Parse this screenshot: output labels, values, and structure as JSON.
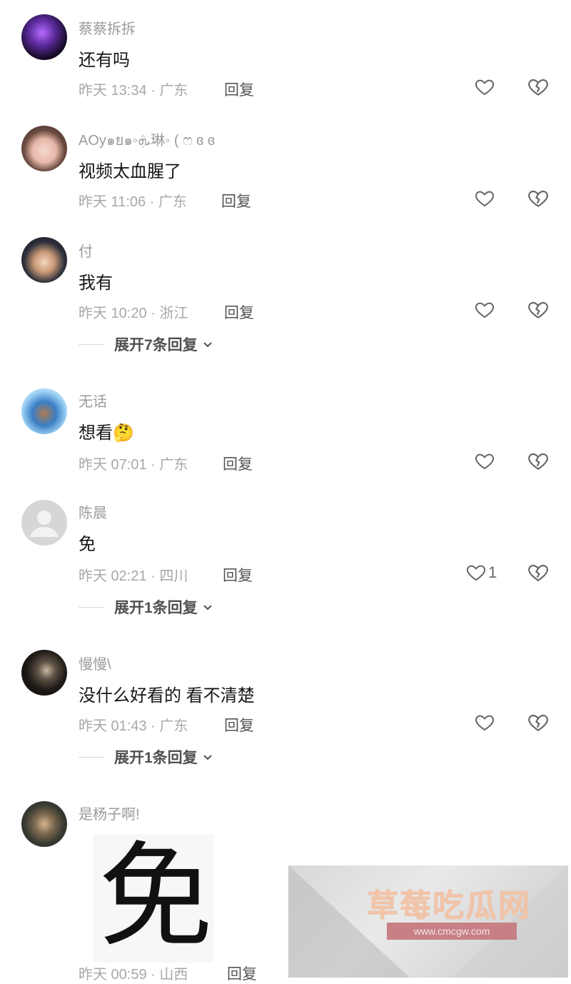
{
  "comments": [
    {
      "user": "蔡蔡拆拆",
      "text": "还有吗",
      "time": "昨天 13:34 · 广东",
      "reply": "回复",
      "likes": ""
    },
    {
      "user": "AOy๑ย๑◦ܞ琳◦ ( ෆ ɞ ɞ",
      "text": "视频太血腥了",
      "time": "昨天 11:06 · 广东",
      "reply": "回复",
      "likes": ""
    },
    {
      "user": "付",
      "text": "我有",
      "time": "昨天 10:20 · 浙江",
      "reply": "回复",
      "likes": "",
      "expand": "展开7条回复"
    },
    {
      "user": "无话",
      "text": "想看",
      "emoji": "🤔",
      "time": "昨天 07:01 · 广东",
      "reply": "回复",
      "likes": ""
    },
    {
      "user": "陈晨",
      "text": "免",
      "time": "昨天 02:21 · 四川",
      "reply": "回复",
      "likes": "1",
      "expand": "展开1条回复"
    },
    {
      "user": "慢慢\\",
      "text": "没什么好看的 看不清楚",
      "time": "昨天 01:43 · 广东",
      "reply": "回复",
      "likes": "",
      "expand": "展开1条回复"
    },
    {
      "user": "是杨子啊!",
      "sticker": "免",
      "time": "昨天 00:59 · 山西",
      "reply": "回复"
    }
  ],
  "watermark": {
    "title": "草莓吃瓜网",
    "url": "www.cmcgw.com"
  },
  "colors": {
    "text": "#161616",
    "meta": "#a8a8a8",
    "icon": "#666666"
  }
}
